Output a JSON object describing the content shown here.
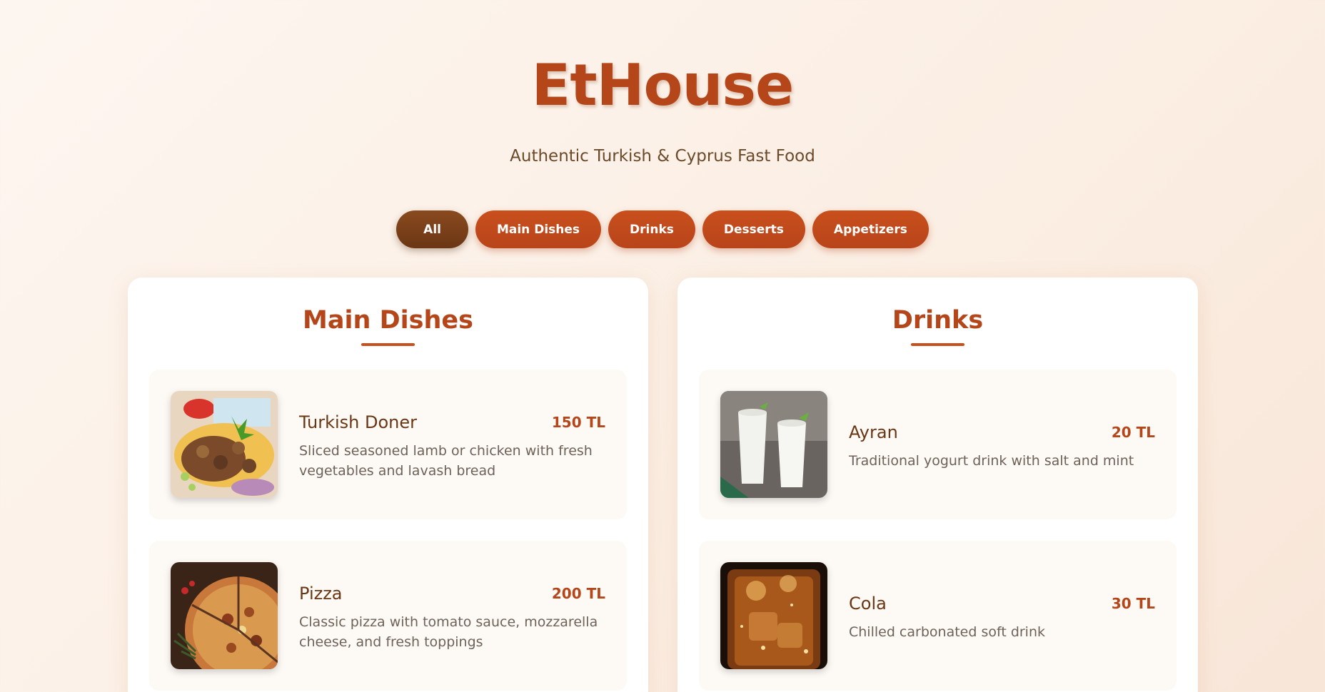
{
  "header": {
    "title": "EtHouse",
    "subtitle": "Authentic Turkish & Cyprus Fast Food"
  },
  "filters": [
    "All",
    "Main Dishes",
    "Drinks",
    "Desserts",
    "Appetizers"
  ],
  "active_filter": "All",
  "sections": [
    {
      "title": "Main Dishes",
      "items": [
        {
          "name": "Turkish Doner",
          "price": "150 TL",
          "description": "Sliced seasoned lamb or chicken with fresh vegetables and lavash bread",
          "image": "doner-photo"
        },
        {
          "name": "Pizza",
          "price": "200 TL",
          "description": "Classic pizza with tomato sauce, mozzarella cheese, and fresh toppings",
          "image": "pizza-photo"
        }
      ]
    },
    {
      "title": "Drinks",
      "items": [
        {
          "name": "Ayran",
          "price": "20 TL",
          "description": "Traditional yogurt drink with salt and mint",
          "image": "ayran-photo"
        },
        {
          "name": "Cola",
          "price": "30 TL",
          "description": "Chilled carbonated soft drink",
          "image": "cola-photo"
        }
      ]
    }
  ],
  "colors": {
    "accent": "#b5461a",
    "active_filter": "#7a3f18",
    "background": "#fbeee3"
  }
}
